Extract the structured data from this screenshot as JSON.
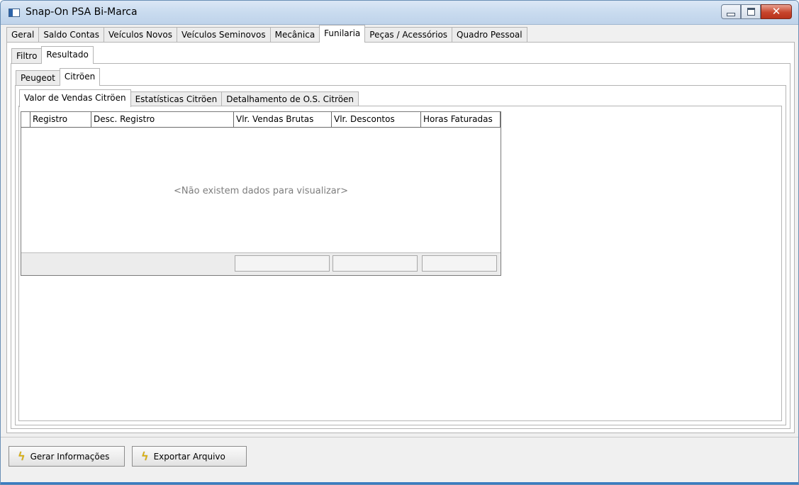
{
  "window": {
    "title": "Snap-On PSA Bi-Marca",
    "close_glyph": "✕"
  },
  "main_tabs": [
    "Geral",
    "Saldo Contas",
    "Veículos Novos",
    "Veículos Seminovos",
    "Mecânica",
    "Funilaria",
    "Peças / Acessórios",
    "Quadro Pessoal"
  ],
  "main_tab_active": "Funilaria",
  "sub_tabs": [
    "Filtro",
    "Resultado"
  ],
  "sub_tab_active": "Resultado",
  "brand_tabs": [
    "Peugeot",
    "Citröen"
  ],
  "brand_tab_active": "Citröen",
  "report_tabs": [
    "Valor de Vendas Citröen",
    "Estatísticas Citröen",
    "Detalhamento de O.S. Citröen"
  ],
  "report_tab_active": "Valor de Vendas Citröen",
  "grid": {
    "columns": [
      "Registro",
      "Desc. Registro",
      "Vlr. Vendas Brutas",
      "Vlr. Descontos",
      "Horas Faturadas"
    ],
    "empty_message": "<Não existem dados para visualizar>"
  },
  "actions": {
    "generate_label": "Gerar Informações",
    "export_label": "Exportar Arquivo",
    "icon": "lightning-bolt-icon",
    "bolt_glyph": "ϟ"
  },
  "colors": {
    "title_bar": "#c9dbef",
    "close_button": "#c7452c",
    "accent_bottom": "#3a7cc0"
  }
}
